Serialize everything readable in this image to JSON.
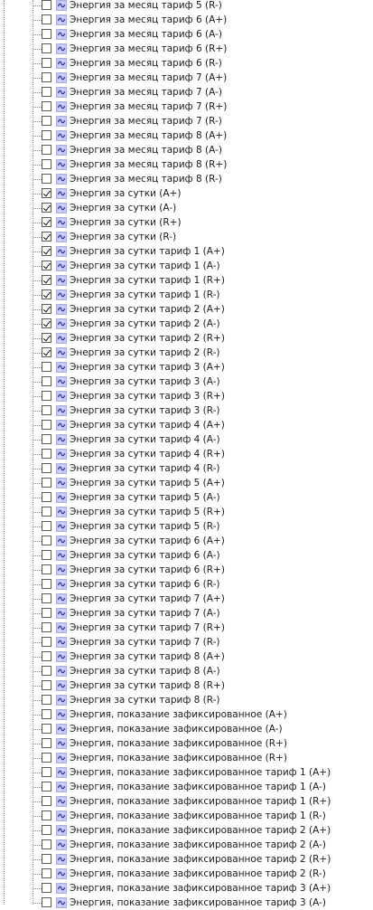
{
  "tree": {
    "items": [
      {
        "label": "Энергия за месяц тариф 5 (R-)",
        "checked": false
      },
      {
        "label": "Энергия за месяц тариф 6 (A+)",
        "checked": false
      },
      {
        "label": "Энергия за месяц тариф 6 (A-)",
        "checked": false
      },
      {
        "label": "Энергия за месяц тариф 6 (R+)",
        "checked": false
      },
      {
        "label": "Энергия за месяц тариф 6 (R-)",
        "checked": false
      },
      {
        "label": "Энергия за месяц тариф 7 (A+)",
        "checked": false
      },
      {
        "label": "Энергия за месяц тариф 7 (A-)",
        "checked": false
      },
      {
        "label": "Энергия за месяц тариф 7 (R+)",
        "checked": false
      },
      {
        "label": "Энергия за месяц тариф 7 (R-)",
        "checked": false
      },
      {
        "label": "Энергия за месяц тариф 8 (A+)",
        "checked": false
      },
      {
        "label": "Энергия за месяц тариф 8 (A-)",
        "checked": false
      },
      {
        "label": "Энергия за месяц тариф 8 (R+)",
        "checked": false
      },
      {
        "label": "Энергия за месяц тариф 8 (R-)",
        "checked": false
      },
      {
        "label": "Энергия за сутки (A+)",
        "checked": true
      },
      {
        "label": "Энергия за сутки (A-)",
        "checked": true
      },
      {
        "label": "Энергия за сутки (R+)",
        "checked": true
      },
      {
        "label": "Энергия за сутки (R-)",
        "checked": true
      },
      {
        "label": "Энергия за сутки тариф 1 (A+)",
        "checked": true
      },
      {
        "label": "Энергия за сутки тариф 1 (A-)",
        "checked": true
      },
      {
        "label": "Энергия за сутки тариф 1 (R+)",
        "checked": true
      },
      {
        "label": "Энергия за сутки тариф 1 (R-)",
        "checked": true
      },
      {
        "label": "Энергия за сутки тариф 2 (A+)",
        "checked": true
      },
      {
        "label": "Энергия за сутки тариф 2 (A-)",
        "checked": true
      },
      {
        "label": "Энергия за сутки тариф 2 (R+)",
        "checked": true
      },
      {
        "label": "Энергия за сутки тариф 2 (R-)",
        "checked": true
      },
      {
        "label": "Энергия за сутки тариф 3 (A+)",
        "checked": false
      },
      {
        "label": "Энергия за сутки тариф 3 (A-)",
        "checked": false
      },
      {
        "label": "Энергия за сутки тариф 3 (R+)",
        "checked": false
      },
      {
        "label": "Энергия за сутки тариф 3 (R-)",
        "checked": false
      },
      {
        "label": "Энергия за сутки тариф 4 (A+)",
        "checked": false
      },
      {
        "label": "Энергия за сутки тариф 4 (A-)",
        "checked": false
      },
      {
        "label": "Энергия за сутки тариф 4 (R+)",
        "checked": false
      },
      {
        "label": "Энергия за сутки тариф 4 (R-)",
        "checked": false
      },
      {
        "label": "Энергия за сутки тариф 5 (A+)",
        "checked": false
      },
      {
        "label": "Энергия за сутки тариф 5 (A-)",
        "checked": false
      },
      {
        "label": "Энергия за сутки тариф 5 (R+)",
        "checked": false
      },
      {
        "label": "Энергия за сутки тариф 5 (R-)",
        "checked": false
      },
      {
        "label": "Энергия за сутки тариф 6 (A+)",
        "checked": false
      },
      {
        "label": "Энергия за сутки тариф 6 (A-)",
        "checked": false
      },
      {
        "label": "Энергия за сутки тариф 6 (R+)",
        "checked": false
      },
      {
        "label": "Энергия за сутки тариф 6 (R-)",
        "checked": false
      },
      {
        "label": "Энергия за сутки тариф 7 (A+)",
        "checked": false
      },
      {
        "label": "Энергия за сутки тариф 7 (A-)",
        "checked": false
      },
      {
        "label": "Энергия за сутки тариф 7 (R+)",
        "checked": false
      },
      {
        "label": "Энергия за сутки тариф 7 (R-)",
        "checked": false
      },
      {
        "label": "Энергия за сутки тариф 8 (A+)",
        "checked": false
      },
      {
        "label": "Энергия за сутки тариф 8 (A-)",
        "checked": false
      },
      {
        "label": "Энергия за сутки тариф 8 (R+)",
        "checked": false
      },
      {
        "label": "Энергия за сутки тариф 8 (R-)",
        "checked": false
      },
      {
        "label": "Энергия, показание зафиксированное (A+)",
        "checked": false
      },
      {
        "label": "Энергия, показание зафиксированное (A-)",
        "checked": false
      },
      {
        "label": "Энергия, показание зафиксированное (R+)",
        "checked": false
      },
      {
        "label": "Энергия, показание зафиксированное (R+)",
        "checked": false
      },
      {
        "label": "Энергия, показание зафиксированное тариф 1 (A+)",
        "checked": false
      },
      {
        "label": "Энергия, показание зафиксированное тариф 1 (A-)",
        "checked": false
      },
      {
        "label": "Энергия, показание зафиксированное тариф 1 (R+)",
        "checked": false
      },
      {
        "label": "Энергия, показание зафиксированное тариф 1 (R-)",
        "checked": false
      },
      {
        "label": "Энергия, показание зафиксированное тариф 2 (A+)",
        "checked": false
      },
      {
        "label": "Энергия, показание зафиксированное тариф 2 (A-)",
        "checked": false
      },
      {
        "label": "Энергия, показание зафиксированное тариф 2 (R+)",
        "checked": false
      },
      {
        "label": "Энергия, показание зафиксированное тариф 2 (R-)",
        "checked": false
      },
      {
        "label": "Энергия, показание зафиксированное тариф 3 (A+)",
        "checked": false
      },
      {
        "label": "Энергия, показание зафиксированное тариф 3 (A-)",
        "checked": false
      }
    ],
    "item_icon": "parameter-wave-icon",
    "colors": {
      "icon_fill": "#c9cdf3",
      "icon_border": "#a6abe6",
      "icon_glyph": "#2b2fa8",
      "tree_line": "#8a8a8a"
    }
  }
}
